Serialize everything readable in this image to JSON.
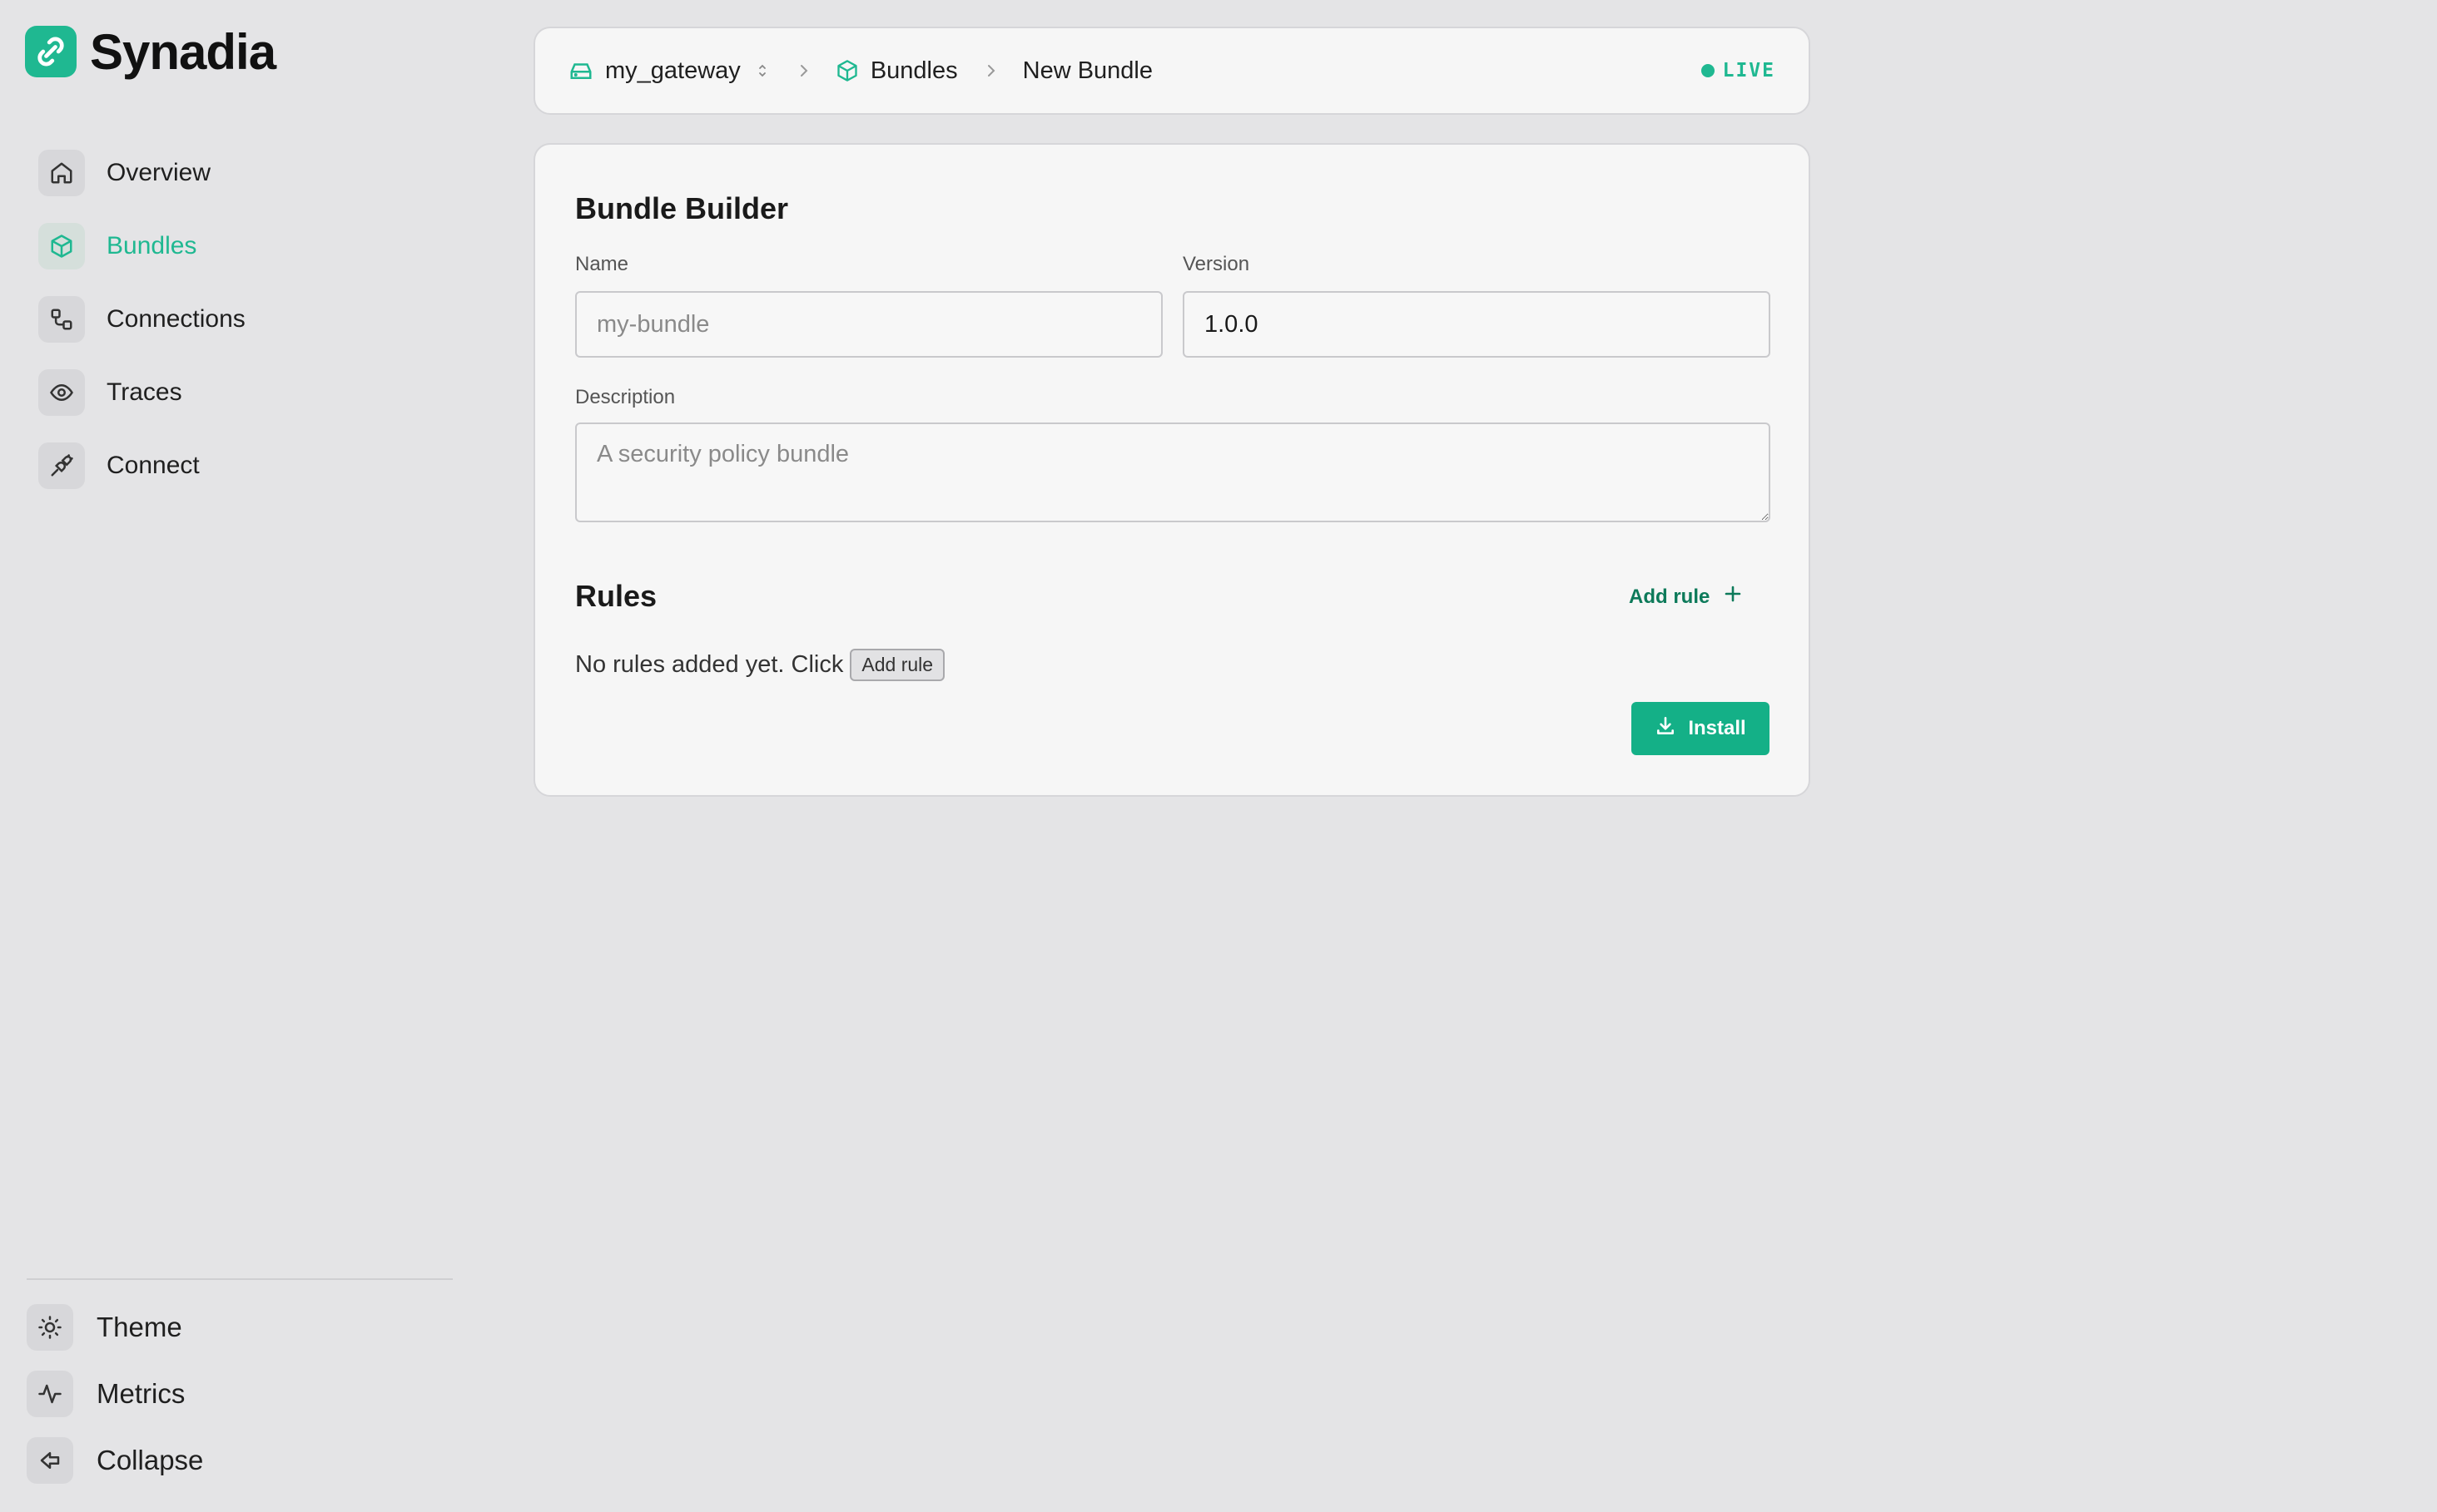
{
  "brand": {
    "name": "Synadia"
  },
  "colors": {
    "accent": "#1fb891",
    "background": "#e4e4e6",
    "card": "#f6f6f6"
  },
  "sidebar": {
    "items": [
      {
        "label": "Overview",
        "icon": "home-icon",
        "active": false
      },
      {
        "label": "Bundles",
        "icon": "package-icon",
        "active": true
      },
      {
        "label": "Connections",
        "icon": "connections-icon",
        "active": false
      },
      {
        "label": "Traces",
        "icon": "eye-icon",
        "active": false
      },
      {
        "label": "Connect",
        "icon": "plug-icon",
        "active": false
      }
    ],
    "bottom": [
      {
        "label": "Theme",
        "icon": "sun-icon"
      },
      {
        "label": "Metrics",
        "icon": "activity-icon"
      },
      {
        "label": "Collapse",
        "icon": "collapse-icon"
      }
    ]
  },
  "breadcrumb": {
    "gateway": "my_gateway",
    "section": "Bundles",
    "current": "New Bundle",
    "status": "LIVE"
  },
  "builder": {
    "title": "Bundle Builder",
    "name_label": "Name",
    "name_placeholder": "my-bundle",
    "name_value": "",
    "version_label": "Version",
    "version_value": "1.0.0",
    "description_label": "Description",
    "description_placeholder": "A security policy bundle",
    "rules_title": "Rules",
    "add_rule_label": "Add rule",
    "empty_text": "No rules added yet. Click",
    "empty_button": "Add rule",
    "install_label": "Install"
  }
}
